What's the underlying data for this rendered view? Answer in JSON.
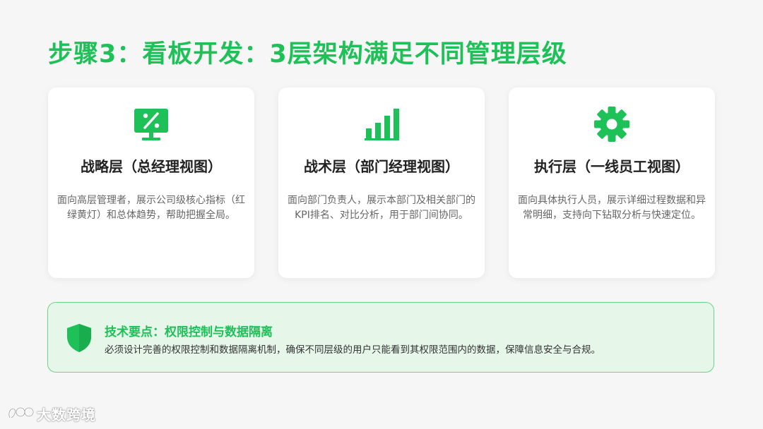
{
  "title": "步骤3：看板开发：3层架构满足不同管理层级",
  "colors": {
    "accent": "#1ec157",
    "tip_background": "#e6f7ea",
    "tip_border": "#6bd38a"
  },
  "cards": [
    {
      "icon": "monitor-percent-icon",
      "heading": "战略层（总经理视图）",
      "desc": "面向高层管理者，展示公司级核心指标（红绿黄灯）和总体趋势，帮助把握全局。"
    },
    {
      "icon": "bar-chart-icon",
      "heading": "战术层（部门经理视图）",
      "desc": "面向部门负责人，展示本部门及相关部门的KPI排名、对比分析，用于部门间协同。"
    },
    {
      "icon": "gear-icon",
      "heading": "执行层（一线员工视图）",
      "desc": "面向具体执行人员，展示详细过程数据和异常明细，支持向下钻取分析与快速定位。"
    }
  ],
  "tip": {
    "icon": "shield-icon",
    "title": "技术要点：权限控制与数据隔离",
    "text": "必须设计完善的权限控制和数据隔离机制，确保不同层级的用户只能看到其权限范围内的数据，保障信息安全与合规。"
  },
  "watermark": {
    "text": "大数跨境"
  }
}
